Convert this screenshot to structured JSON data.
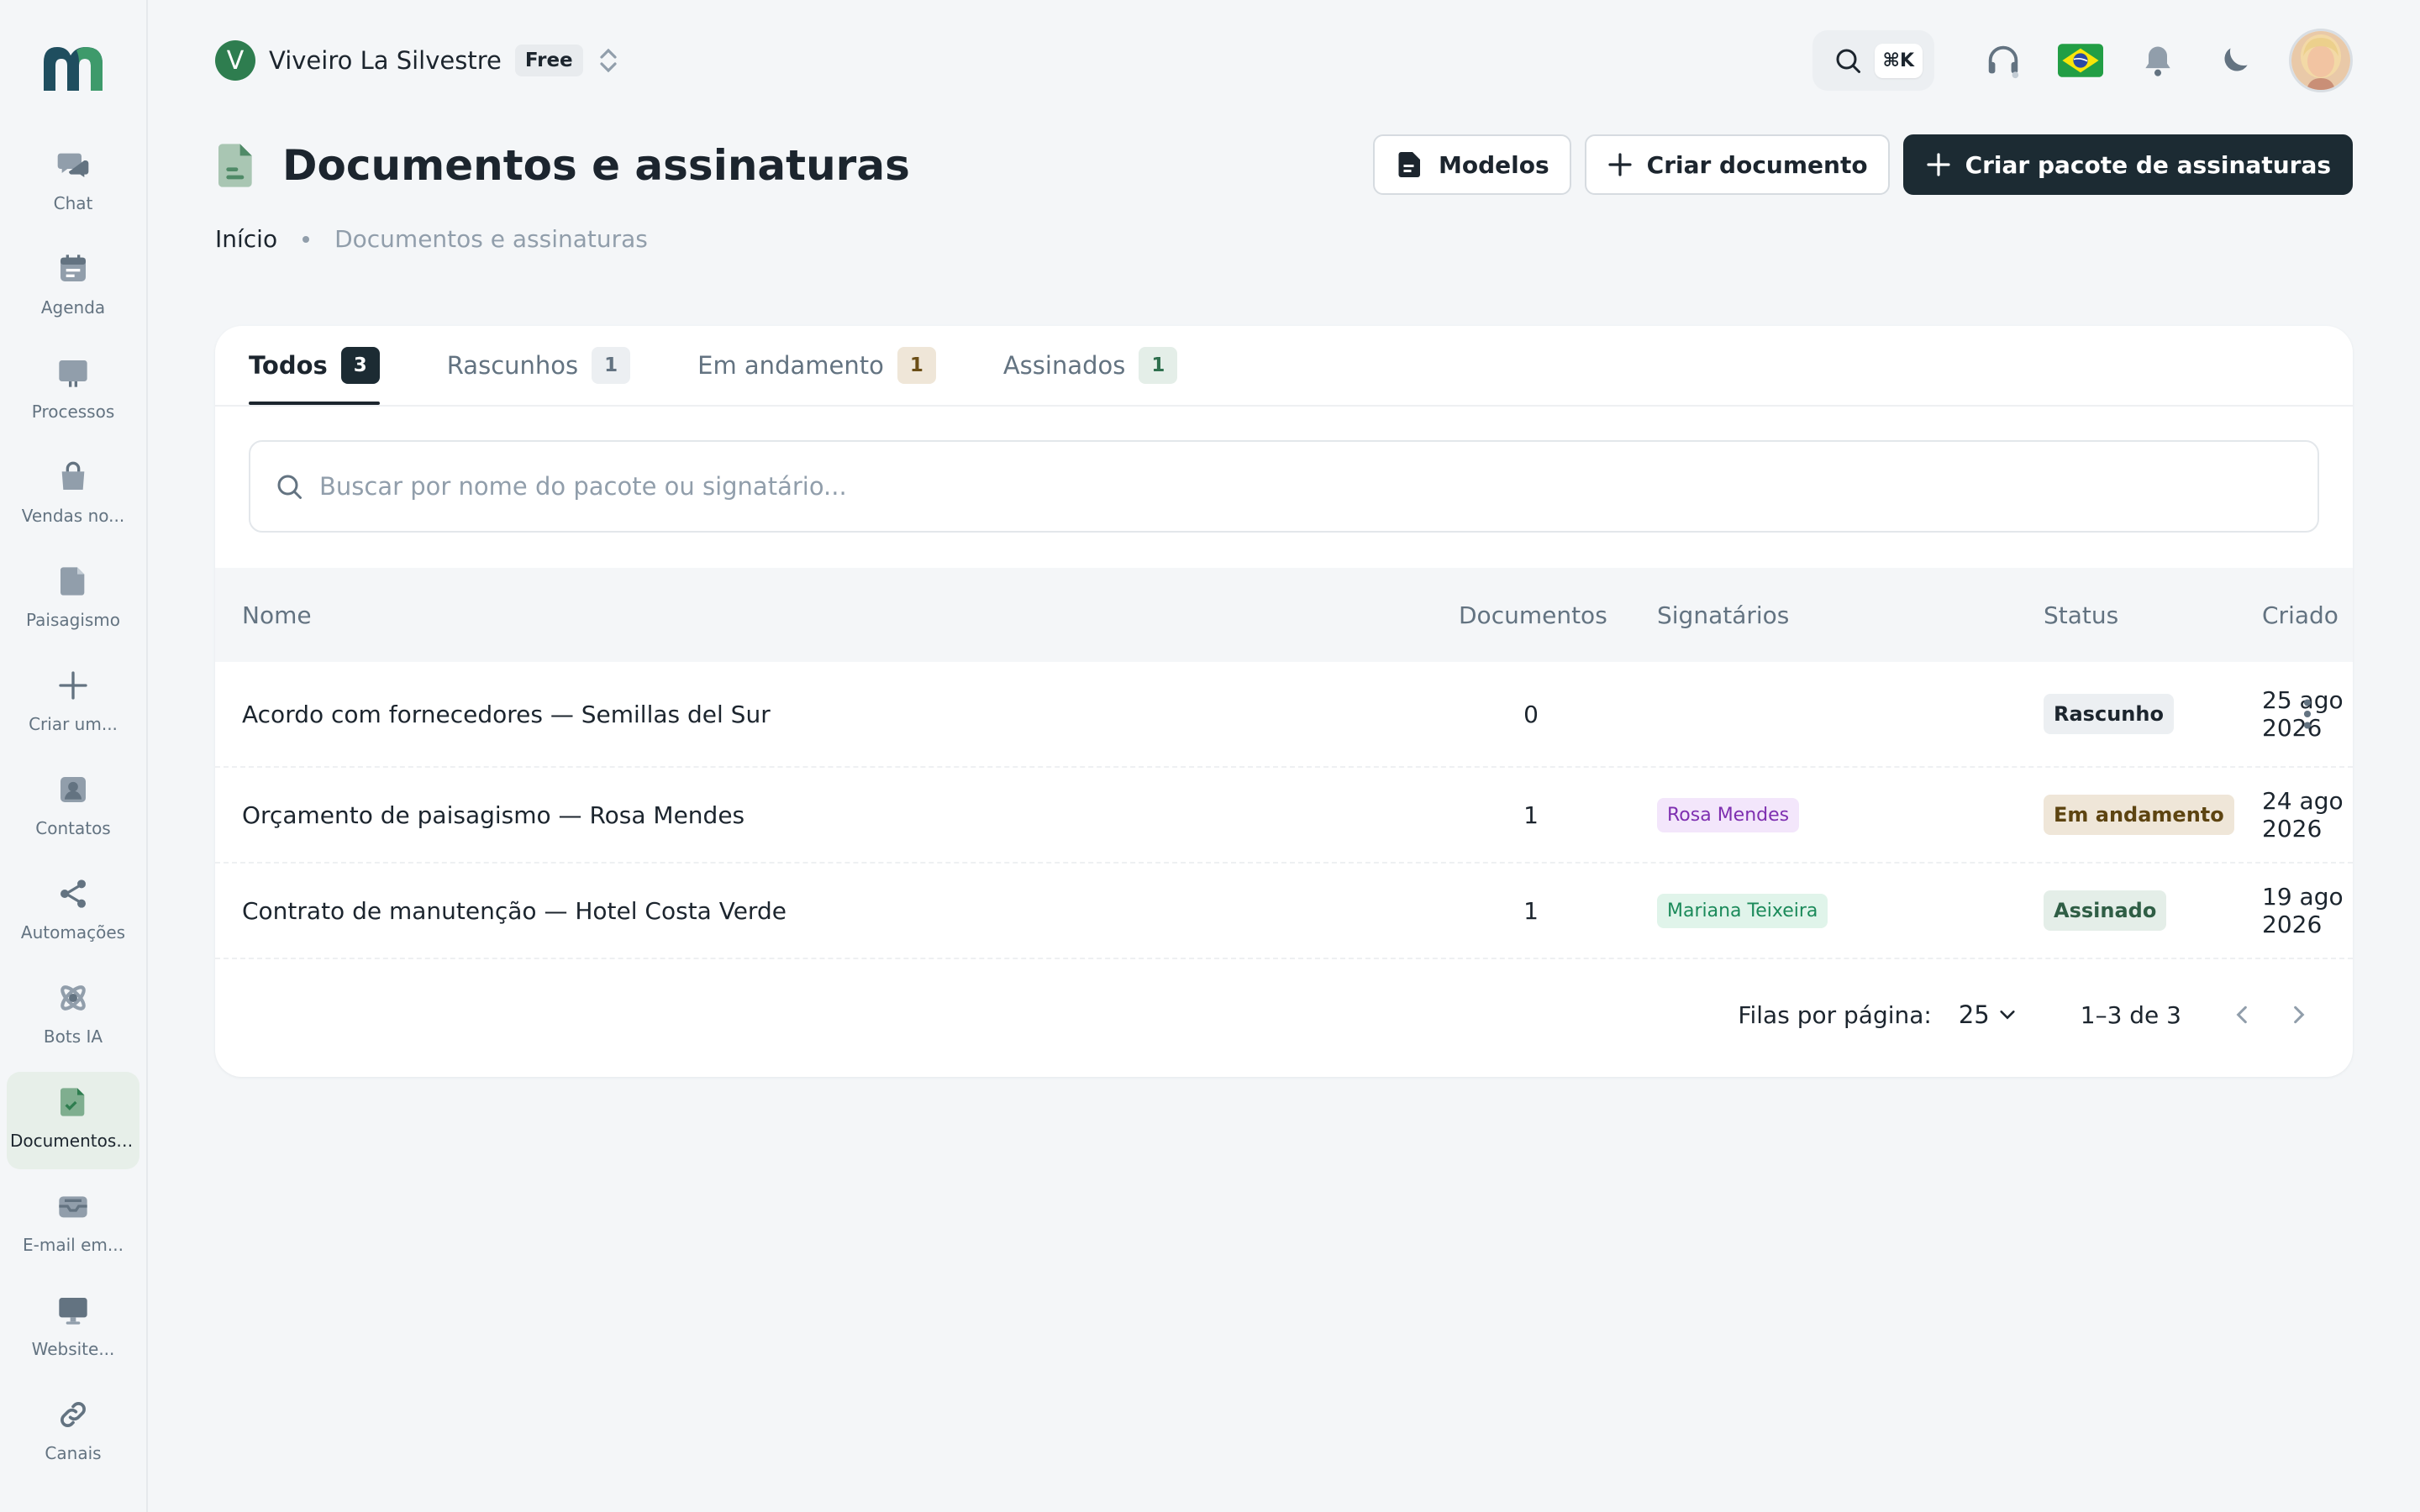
{
  "colors": {
    "accent_dark": "#1c2b33",
    "brand_green": "#2e7d4f",
    "sidebar_active_bg": "#e7efe9"
  },
  "sidebar": {
    "logo_icon": "brand-logo-icon",
    "items": [
      {
        "label": "Chat",
        "icon": "chat-icon",
        "active": false
      },
      {
        "label": "Agenda",
        "icon": "calendar-icon",
        "active": false
      },
      {
        "label": "Processos",
        "icon": "kanban-board-icon",
        "active": false
      },
      {
        "label": "Vendas no...",
        "icon": "shopping-bag-icon",
        "active": false
      },
      {
        "label": "Paisagismo",
        "icon": "file-icon",
        "active": false
      },
      {
        "label": "Criar um...",
        "icon": "plus-icon",
        "active": false
      },
      {
        "label": "Contatos",
        "icon": "contact-icon",
        "active": false
      },
      {
        "label": "Automações",
        "icon": "share-nodes-icon",
        "active": false
      },
      {
        "label": "Bots IA",
        "icon": "atom-icon",
        "active": false
      },
      {
        "label": "Documentos ...",
        "icon": "document-check-icon",
        "active": true
      },
      {
        "label": "E-mail em...",
        "icon": "inbox-icon",
        "active": false
      },
      {
        "label": "Website...",
        "icon": "monitor-icon",
        "active": false
      },
      {
        "label": "Canais",
        "icon": "link-icon",
        "active": false
      }
    ]
  },
  "topbar": {
    "workspace_initial": "V",
    "workspace_name": "Viveiro La Silvestre",
    "plan": "Free",
    "search_shortcut": "⌘K"
  },
  "header": {
    "title": "Documentos e assinaturas",
    "breadcrumb": {
      "home": "Início",
      "current": "Documentos e assinaturas"
    },
    "buttons": {
      "templates": "Modelos",
      "create_document": "Criar documento",
      "create_package": "Criar pacote de assinaturas"
    }
  },
  "tabs": [
    {
      "label": "Todos",
      "count": "3",
      "active": true
    },
    {
      "label": "Rascunhos",
      "count": "1",
      "active": false
    },
    {
      "label": "Em andamento",
      "count": "1",
      "active": false
    },
    {
      "label": "Assinados",
      "count": "1",
      "active": false
    }
  ],
  "search": {
    "placeholder": "Buscar por nome do pacote ou signatário..."
  },
  "table": {
    "columns": {
      "name": "Nome",
      "documents": "Documentos",
      "signers": "Signatários",
      "status": "Status",
      "created": "Criado"
    },
    "rows": [
      {
        "name": "Acordo com fornecedores — Semillas del Sur",
        "documents": "0",
        "signer": "",
        "status": "Rascunho",
        "created": "25 ago 2026"
      },
      {
        "name": "Orçamento de paisagismo — Rosa Mendes",
        "documents": "1",
        "signer": "Rosa Mendes",
        "status": "Em andamento",
        "created": "24 ago 2026"
      },
      {
        "name": "Contrato de manutenção — Hotel Costa Verde",
        "documents": "1",
        "signer": "Mariana Teixeira",
        "status": "Assinado",
        "created": "19 ago 2026"
      }
    ]
  },
  "pagination": {
    "rows_per_page_label": "Filas por página:",
    "rows_per_page": "25",
    "range": "1–3 de 3"
  }
}
